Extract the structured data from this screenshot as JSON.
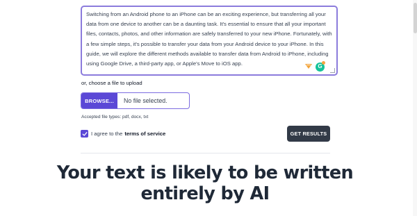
{
  "editor": {
    "text": "Switching from an Android phone to an iPhone can be an exciting experience, but transferring all your data from one device to another can be a daunting task. It's essential to ensure that all your important files, contacts, photos, and other information are safely transferred to your new iPhone. Fortunately, with a few simple steps, it's possible to transfer your data from your Android device to your iPhone. In this guide, we will explore the different methods available to transfer data from Android to iPhone, including using Google Drive, a third-party app, or Apple's Move to iOS app.",
    "icons": [
      "emoji-icon",
      "grammarly-icon"
    ],
    "grammarly_letter": "G"
  },
  "upload": {
    "label": "or, choose a file to upload",
    "browse_label": "BROWSE...",
    "file_status": "No file selected.",
    "accepted_types": "Accepted file types: pdf, docx, txt"
  },
  "agreement": {
    "checked": true,
    "prefix": "I agree to the",
    "link_text": "terms of service"
  },
  "actions": {
    "get_results_label": "GET RESULTS"
  },
  "result": {
    "headline": "Your text is likely to be written entirely by AI"
  },
  "colors": {
    "accent": "#5b48d6",
    "button_dark": "#323a47",
    "grammarly_green": "#15c39a"
  }
}
